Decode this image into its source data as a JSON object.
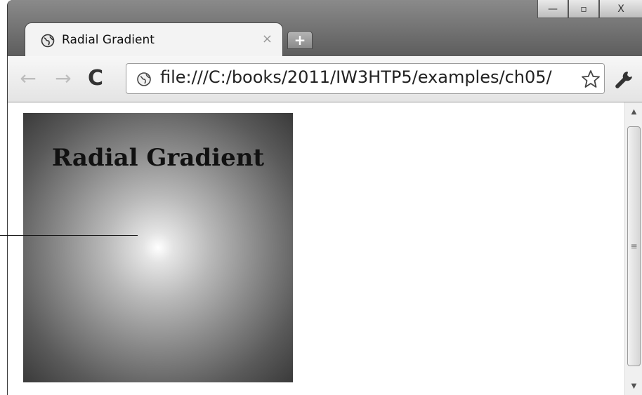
{
  "tab": {
    "title": "Radial Gradient",
    "close_glyph": "×",
    "new_tab_glyph": "+"
  },
  "window_controls": {
    "minimize_glyph": "—",
    "maximize_glyph": "▫",
    "close_glyph": "X"
  },
  "toolbar": {
    "back_glyph": "←",
    "forward_glyph": "→",
    "reload_glyph": "C",
    "url": "file:///C:/books/2011/IW3HTP5/examples/ch05/"
  },
  "page": {
    "heading": "Radial Gradient"
  },
  "scrollbar": {
    "up_glyph": "▲",
    "down_glyph": "▼",
    "grip_glyph": "≡"
  },
  "icons": {
    "tab": "globe-icon",
    "address": "globe-icon",
    "bookmark": "star-icon",
    "menu": "wrench-icon"
  }
}
